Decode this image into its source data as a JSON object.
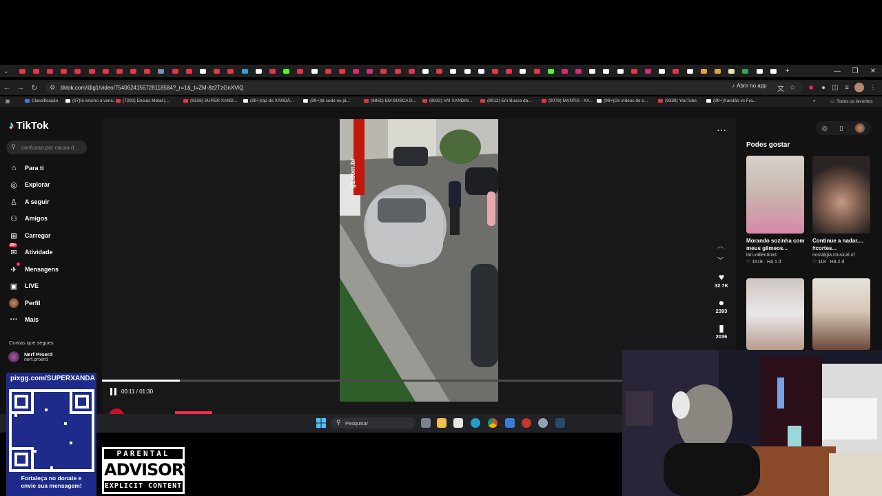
{
  "browser": {
    "url": "tiktok.com/@g1/video/7540624156728118584?_r=1&_t=ZM-8z2TzGnXViQ",
    "open_in_app": "Abrir no app",
    "tab_favicon_colors": [
      "#e8344a",
      "#e8344a",
      "#e8344a",
      "#e8344a",
      "#e8344a",
      "#e8344a",
      "#e8344a",
      "#e8344a",
      "#e8344a",
      "#e8344a",
      "#7d8fb8",
      "#e8344a",
      "#e8344a",
      "#ffffff",
      "#e8344a",
      "#e8344a",
      "#2aa3e0",
      "#ffffff",
      "#e8344a",
      "#53fc18",
      "#e8344a",
      "#ffffff",
      "#e8344a",
      "#e8344a",
      "#d62976",
      "#d62976",
      "#e8344a",
      "#e8344a",
      "#e8344a",
      "#ffffff",
      "#e8344a",
      "#ffffff",
      "#ffffff",
      "#ffffff",
      "#e8344a",
      "#e8344a",
      "#ffffff",
      "#e8344a",
      "#53fc18",
      "#d62976",
      "#d62976",
      "#ffffff",
      "#ffffff",
      "#ffffff",
      "#e8344a",
      "#d62976",
      "#ffffff",
      "#e8344a",
      "#ffffff",
      "#e3a53b",
      "#e3a53b",
      "#e6e6b0",
      "#2fa84f",
      "#ffffff",
      "#ffffff"
    ],
    "bookmarks": [
      {
        "label": "Classificação",
        "color": "#4a7ae0"
      },
      {
        "label": "(97)Ie ensino a venc...",
        "color": "#ffffff"
      },
      {
        "label": "(7292) Eneias Metal |...",
        "color": "#e8344a"
      },
      {
        "label": "(8159) SUPER XAND...",
        "color": "#e8344a"
      },
      {
        "label": "(99+)rap do XANDÃ...",
        "color": "#ffffff"
      },
      {
        "label": "(99+)tá cedo ou já...",
        "color": "#ffffff"
      },
      {
        "label": "(8851) EM BUSCA D...",
        "color": "#e8344a"
      },
      {
        "label": "(8912) VAI XANDIN...",
        "color": "#e8344a"
      },
      {
        "label": "(8912) Em Busca da...",
        "color": "#e8344a"
      },
      {
        "label": "(9078) MANTIS - XA...",
        "color": "#e8344a"
      },
      {
        "label": "(99+)Os vídeos de c...",
        "color": "#ffffff"
      },
      {
        "label": "(9338) YouTube",
        "color": "#e8344a"
      },
      {
        "label": "(99+)Xandão vs Fra...",
        "color": "#ffffff"
      }
    ],
    "all_bookmarks": "Todos os favoritos"
  },
  "tiktok": {
    "logo": "TikTok",
    "search_placeholder": "confusao por causa d...",
    "nav": [
      {
        "label": "Para ti",
        "icon": "home-icon"
      },
      {
        "label": "Explorar",
        "icon": "compass-icon"
      },
      {
        "label": "A seguir",
        "icon": "following-icon"
      },
      {
        "label": "Amigos",
        "icon": "friends-icon"
      },
      {
        "label": "Carregar",
        "icon": "upload-icon"
      },
      {
        "label": "Atividade",
        "icon": "activity-icon",
        "badge": "99+"
      },
      {
        "label": "Mensagens",
        "icon": "messages-icon"
      },
      {
        "label": "LIVE",
        "icon": "live-icon"
      },
      {
        "label": "Perfil",
        "icon": "profile-avatar"
      },
      {
        "label": "Mais",
        "icon": "more-icon"
      }
    ],
    "following_title": "Contas que segues",
    "following": [
      {
        "name": "Nerf Proerd",
        "handle": "nerf.proerd"
      }
    ],
    "player": {
      "time": "00:11 / 01:30",
      "progress": 0.15,
      "watermark": "g1.com.br",
      "author_avatar_text": "g1"
    },
    "actions": [
      {
        "icon": "heart-icon",
        "count": "32.7K"
      },
      {
        "icon": "comment-icon",
        "count": "2393"
      },
      {
        "icon": "bookmark-icon",
        "count": "2036"
      }
    ],
    "suggest_title": "Podes gostar",
    "suggestions": [
      {
        "caption": "Morando sozinha com meus gêmeos...",
        "user": "lari.vallentina1",
        "likes": "1518",
        "age": "Há 1 d"
      },
      {
        "caption": "Continue a nadar.... #cortes...",
        "user": "nostalgia.musical.of",
        "likes": "118",
        "age": "Há 2 d"
      },
      {
        "caption": "",
        "user": "",
        "likes": "",
        "age": ""
      },
      {
        "caption": "",
        "user": "",
        "likes": "",
        "age": ""
      }
    ]
  },
  "taskbar": {
    "search_placeholder": "Pesquisar"
  },
  "overlay": {
    "pix_title": "pixgg.com/SUPERXANDÃ",
    "pix_message_line1": "Fortaleça no donate e",
    "pix_message_line2": "envie sua mensagem!",
    "advisory_top": "PARENTAL",
    "advisory_mid": "ADVISORY",
    "advisory_bottom": "EXPLICIT CONTENT"
  },
  "colors": {
    "accent": "#fe2c55",
    "page_bg": "#121212",
    "pix_panel": "#1e2b8a"
  }
}
